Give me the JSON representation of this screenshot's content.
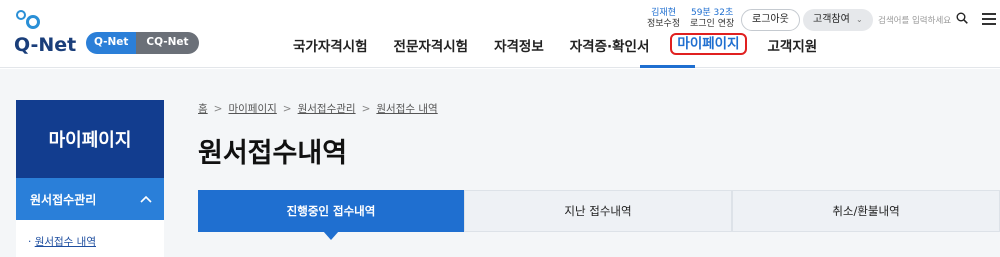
{
  "header": {
    "logo_text": "Q-Net",
    "brand_qnet": "Q-Net",
    "brand_cqnet": "CQ-Net",
    "nav": [
      {
        "label": "국가자격시험"
      },
      {
        "label": "전문자격시험"
      },
      {
        "label": "자격정보"
      },
      {
        "label": "자격증·확인서"
      },
      {
        "label": "마이페이지"
      },
      {
        "label": "고객지원"
      }
    ],
    "user_name": "김재현",
    "user_info_edit": "정보수정",
    "session_timer": "59분 32초",
    "login_extend": "로그인 연장",
    "logout_label": "로그아웃",
    "customer_label": "고객참여",
    "search_placeholder": "검색어를 입력하세요"
  },
  "sidebar": {
    "title": "마이페이지",
    "section_label": "원서접수관리",
    "items": [
      {
        "label": "원서접수 내역"
      }
    ]
  },
  "breadcrumb": [
    "홈",
    "마이페이지",
    "원서접수관리",
    "원서접수 내역"
  ],
  "page_title": "원서접수내역",
  "tabs": [
    {
      "label": "진행중인 접수내역",
      "active": true
    },
    {
      "label": "지난 접수내역",
      "active": false
    },
    {
      "label": "취소/환불내역",
      "active": false
    }
  ],
  "colors": {
    "primary": "#1f6fd0",
    "navy": "#123d8f",
    "highlight_border": "#e02020"
  }
}
